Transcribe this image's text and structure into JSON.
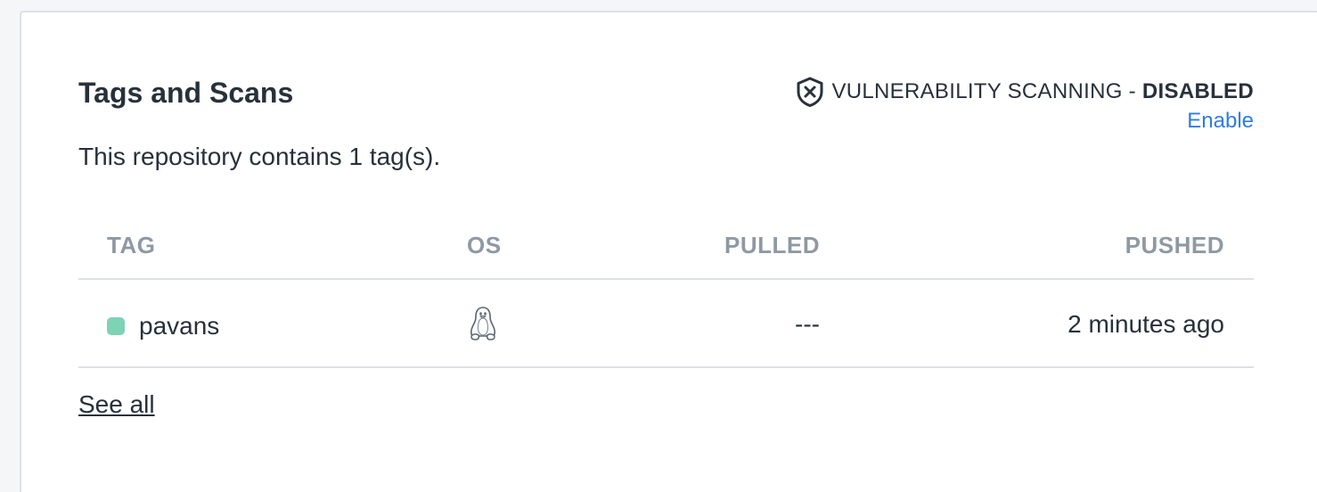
{
  "section": {
    "title": "Tags and Scans",
    "description": "This repository contains 1 tag(s)."
  },
  "scanning": {
    "icon": "shield-x-icon",
    "label": "VULNERABILITY SCANNING - ",
    "status": "DISABLED",
    "enable_label": "Enable"
  },
  "table": {
    "columns": {
      "tag": "TAG",
      "os": "OS",
      "pulled": "PULLED",
      "pushed": "PUSHED"
    },
    "rows": [
      {
        "tag": "pavans",
        "tag_color": "#7dd3b4",
        "os_icon": "linux-penguin-icon",
        "pulled": "---",
        "pushed": "2 minutes ago"
      }
    ]
  },
  "see_all_label": "See all",
  "colors": {
    "link": "#2f7de1",
    "header_text": "#8f99a3",
    "tag_indicator": "#7dd3b4"
  }
}
